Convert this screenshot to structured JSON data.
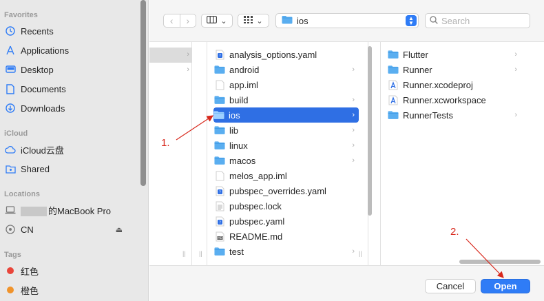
{
  "sidebar": {
    "favorites_title": "Favorites",
    "favorites": [
      {
        "label": "Recents",
        "icon": "clock-icon"
      },
      {
        "label": "Applications",
        "icon": "applications-icon"
      },
      {
        "label": "Desktop",
        "icon": "desktop-icon"
      },
      {
        "label": "Documents",
        "icon": "document-icon"
      },
      {
        "label": "Downloads",
        "icon": "downloads-icon"
      }
    ],
    "icloud_title": "iCloud",
    "icloud": [
      {
        "label": "iCloud云盘",
        "icon": "cloud-icon"
      },
      {
        "label": "Shared",
        "icon": "shared-folder-icon"
      }
    ],
    "locations_title": "Locations",
    "locations": [
      {
        "label": "的MacBook Pro",
        "icon": "laptop-icon"
      },
      {
        "label": "CN",
        "icon": "network-disk-icon"
      }
    ],
    "tags_title": "Tags",
    "tags": [
      {
        "label": "红色",
        "color": "#e9453a"
      },
      {
        "label": "橙色",
        "color": "#f0932b"
      }
    ]
  },
  "toolbar": {
    "back_glyph": "‹",
    "forward_glyph": "›",
    "path_folder": "ios",
    "search_placeholder": "Search"
  },
  "column2": [
    {
      "name": "analysis_options.yaml",
      "kind": "yaml",
      "folder": false
    },
    {
      "name": "android",
      "kind": "folder",
      "folder": true
    },
    {
      "name": "app.iml",
      "kind": "file",
      "folder": false
    },
    {
      "name": "build",
      "kind": "folder",
      "folder": true
    },
    {
      "name": "ios",
      "kind": "folder",
      "folder": true,
      "selected": true
    },
    {
      "name": "lib",
      "kind": "folder",
      "folder": true
    },
    {
      "name": "linux",
      "kind": "folder",
      "folder": true
    },
    {
      "name": "macos",
      "kind": "folder",
      "folder": true
    },
    {
      "name": "melos_app.iml",
      "kind": "file",
      "folder": false
    },
    {
      "name": "pubspec_overrides.yaml",
      "kind": "yaml",
      "folder": false
    },
    {
      "name": "pubspec.lock",
      "kind": "text",
      "folder": false
    },
    {
      "name": "pubspec.yaml",
      "kind": "yaml",
      "folder": false
    },
    {
      "name": "README.md",
      "kind": "md",
      "folder": false
    },
    {
      "name": "test",
      "kind": "folder",
      "folder": true
    }
  ],
  "column3": [
    {
      "name": "Flutter",
      "kind": "folder",
      "folder": true
    },
    {
      "name": "Runner",
      "kind": "folder",
      "folder": true
    },
    {
      "name": "Runner.xcodeproj",
      "kind": "xcode",
      "folder": false
    },
    {
      "name": "Runner.xcworkspace",
      "kind": "xcode",
      "folder": false
    },
    {
      "name": "RunnerTests",
      "kind": "folder",
      "folder": true
    }
  ],
  "buttons": {
    "cancel": "Cancel",
    "open": "Open"
  },
  "annotations": {
    "step1": "1.",
    "step2": "2.",
    "color": "#d8281c"
  },
  "colors": {
    "accent": "#2f7cf6",
    "selection": "#2f6fe4",
    "folder": "#5aaef0"
  }
}
